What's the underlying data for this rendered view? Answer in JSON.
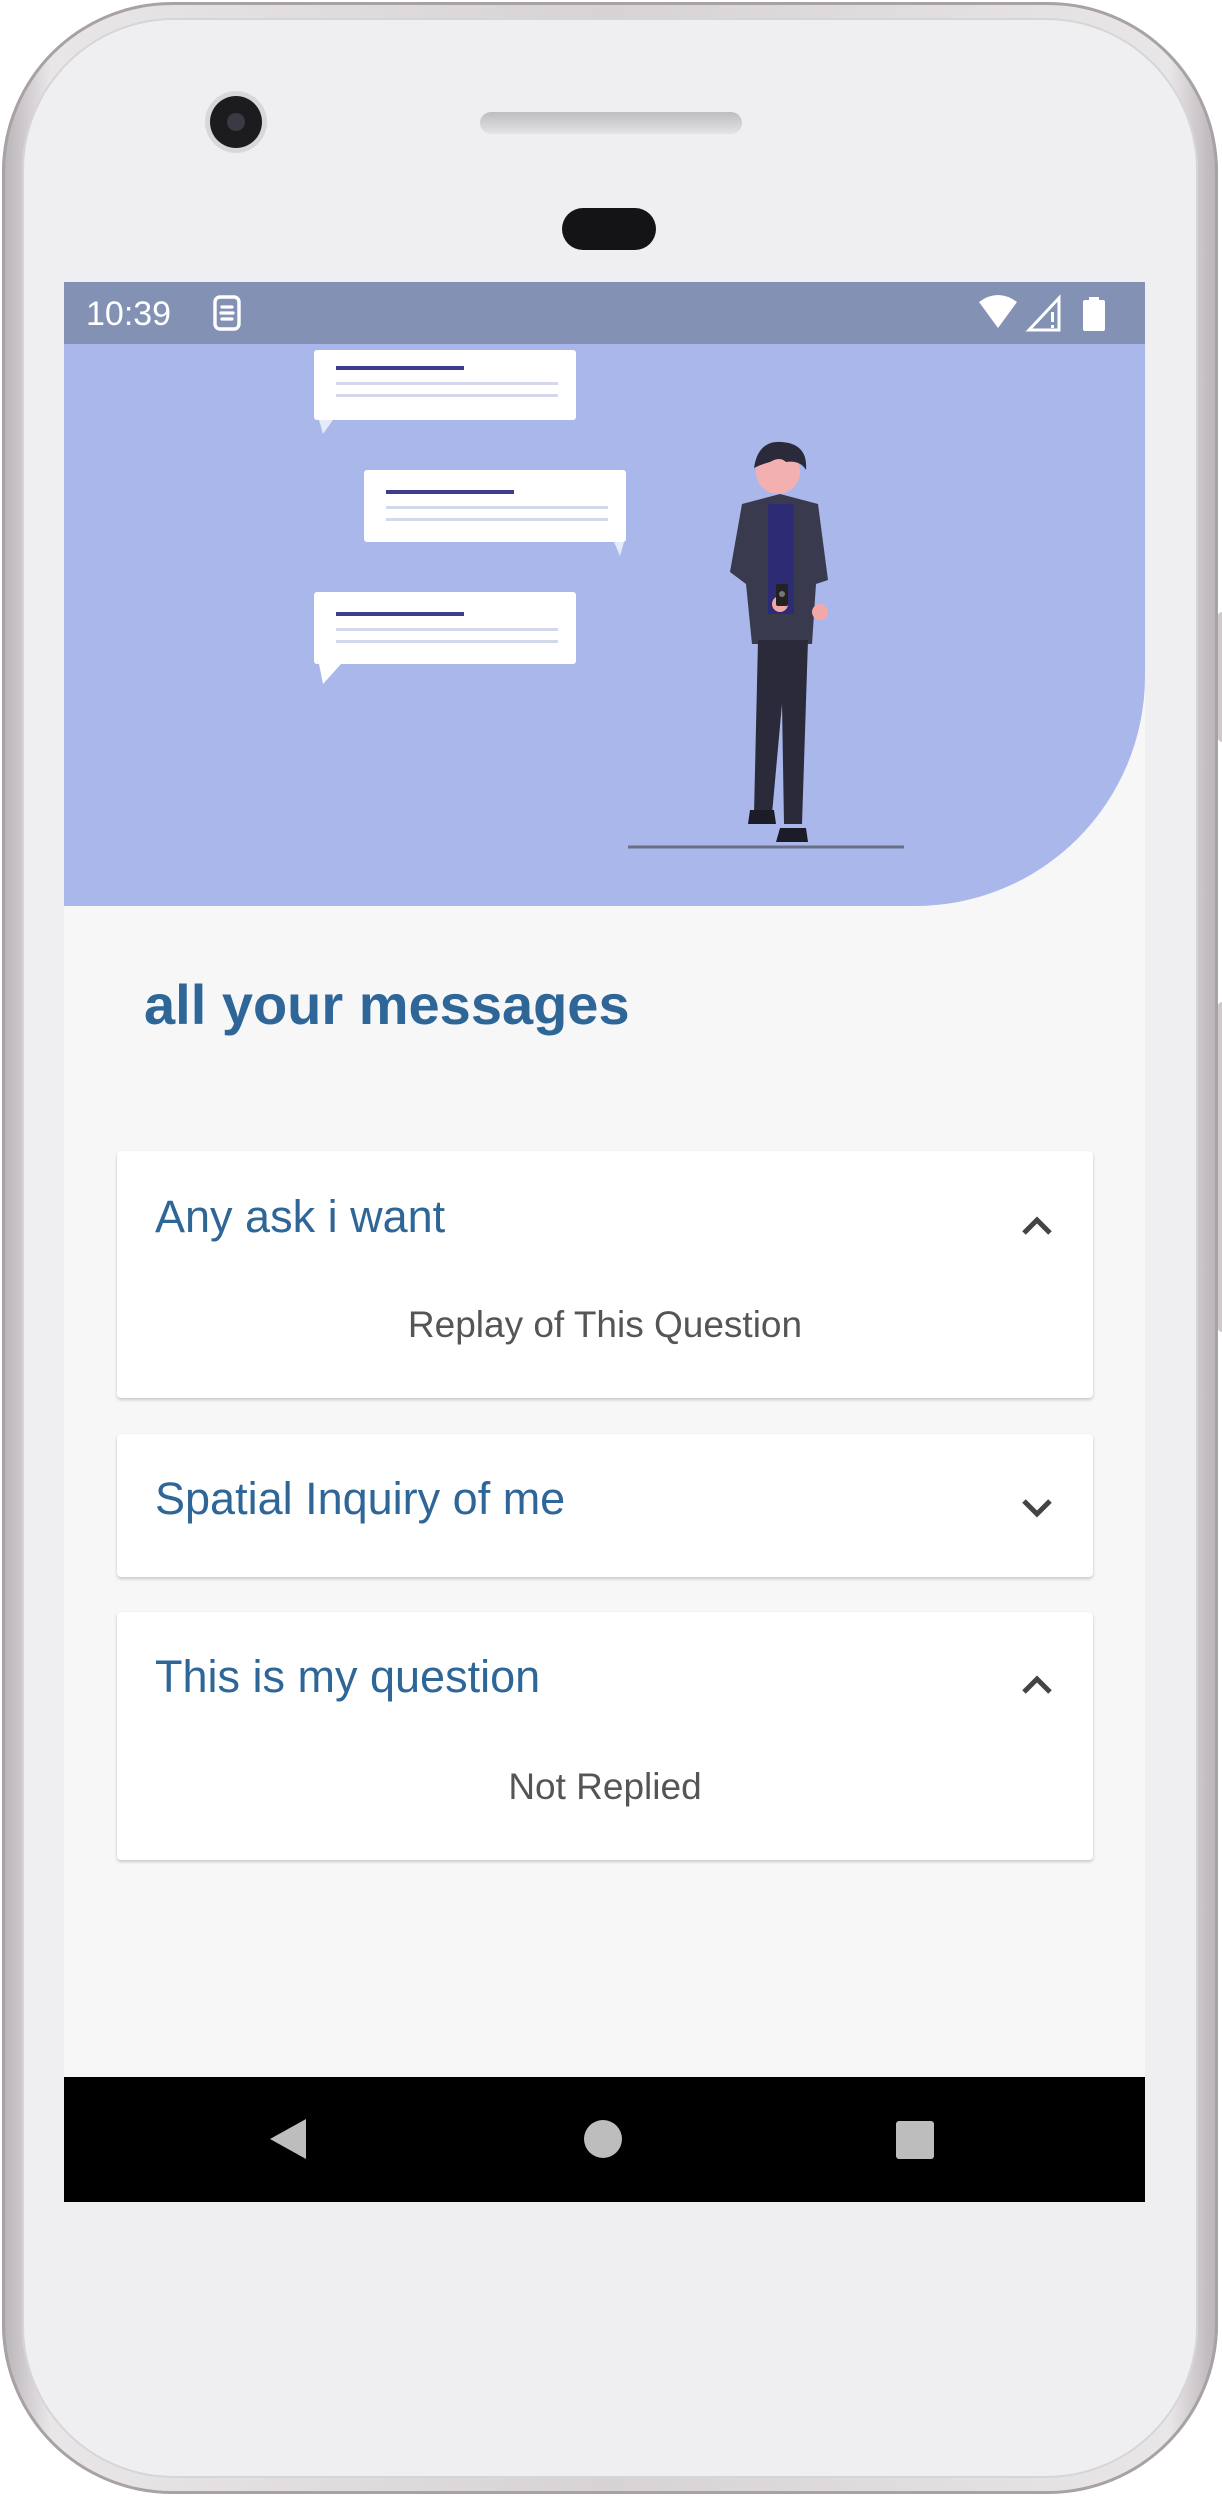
{
  "status_bar": {
    "time": "10:39",
    "icons": [
      "sim-notification-icon",
      "wifi-icon",
      "signal-icon",
      "battery-icon"
    ]
  },
  "hero": {
    "illustration": "person-with-message-bubbles-illustration"
  },
  "page_title": "all your messages",
  "messages": [
    {
      "question": "Any ask i want",
      "expanded": true,
      "reply": "Replay of This Question",
      "chevron": "chevron-up-icon"
    },
    {
      "question": "Spatial Inquiry of me",
      "expanded": false,
      "reply": "",
      "chevron": "chevron-down-icon"
    },
    {
      "question": "This is my question",
      "expanded": true,
      "reply": "Not Replied",
      "chevron": "chevron-up-icon"
    }
  ],
  "nav_bar": {
    "buttons": [
      "back-icon",
      "home-icon",
      "recents-icon"
    ]
  },
  "colors": {
    "status_bar": "#8391b5",
    "hero": "#a9b7eb",
    "title": "#2e6698",
    "reply_text": "#555555",
    "background": "#f7f7f8"
  }
}
